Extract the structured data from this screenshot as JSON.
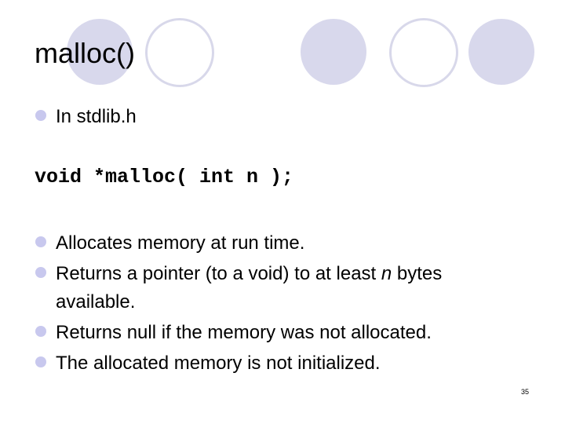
{
  "slide": {
    "title": "malloc()",
    "bullet1": "In stdlib.h",
    "code": "void *malloc( int n );",
    "bullets": [
      "Allocates memory at run time.",
      {
        "before": "Returns a pointer (to a void) to at least ",
        "italic": "n",
        "after": " bytes",
        "continuation": "available."
      },
      "Returns null if the memory was not allocated.",
      "The allocated memory is not initialized."
    ],
    "page_number": "35"
  },
  "theme": {
    "circle_color": "#d8d8ec",
    "bullet_color": "#c8c8ee"
  }
}
